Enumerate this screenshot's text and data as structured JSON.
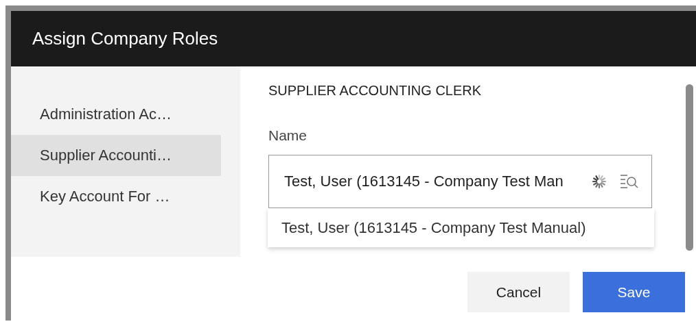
{
  "window": {
    "title": "Assign Company Roles"
  },
  "sidebar": {
    "items": [
      {
        "label": "Administration Ac…",
        "selected": false
      },
      {
        "label": "Supplier Accounti…",
        "selected": true
      },
      {
        "label": "Key Account For …",
        "selected": false
      }
    ]
  },
  "role": {
    "title": "SUPPLIER ACCOUNTING CLERK",
    "field": {
      "label": "Name",
      "value": "Test, User (1613145 - Company Test Man",
      "loading": true
    },
    "suggestions": [
      "Test, User (1613145 - Company Test Manual)"
    ]
  },
  "buttons": [
    {
      "label": "Cancel",
      "kind": "secondary"
    },
    {
      "label": "Save",
      "kind": "primary"
    }
  ]
}
